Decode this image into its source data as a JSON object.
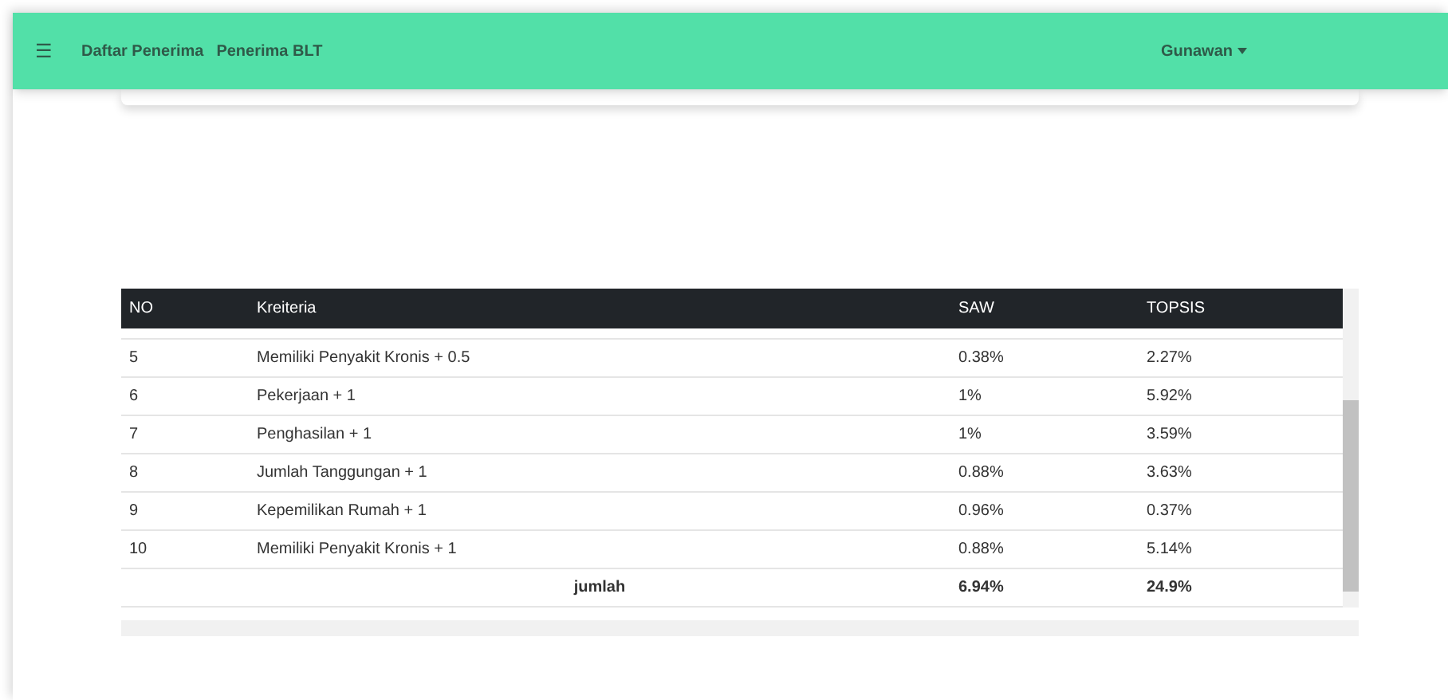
{
  "navbar": {
    "menu_icon": "☰",
    "links": [
      "Daftar Penerima",
      "Penerima BLT"
    ],
    "user": "Gunawan"
  },
  "table": {
    "columns": [
      "NO",
      "Kreiteria",
      "SAW",
      "TOPSIS"
    ],
    "rows": [
      {
        "no": "5",
        "kriteria": "Memiliki Penyakit Kronis + 0.5",
        "saw": "0.38%",
        "topsis": "2.27%"
      },
      {
        "no": "6",
        "kriteria": "Pekerjaan + 1",
        "saw": "1%",
        "topsis": "5.92%"
      },
      {
        "no": "7",
        "kriteria": "Penghasilan + 1",
        "saw": "1%",
        "topsis": "3.59%"
      },
      {
        "no": "8",
        "kriteria": "Jumlah Tanggungan + 1",
        "saw": "0.88%",
        "topsis": "3.63%"
      },
      {
        "no": "9",
        "kriteria": "Kepemilikan Rumah + 1",
        "saw": "0.96%",
        "topsis": "0.37%"
      },
      {
        "no": "10",
        "kriteria": "Memiliki Penyakit Kronis + 1",
        "saw": "0.88%",
        "topsis": "5.14%"
      }
    ],
    "total": {
      "label": "jumlah",
      "saw": "6.94%",
      "topsis": "24.9%"
    }
  }
}
